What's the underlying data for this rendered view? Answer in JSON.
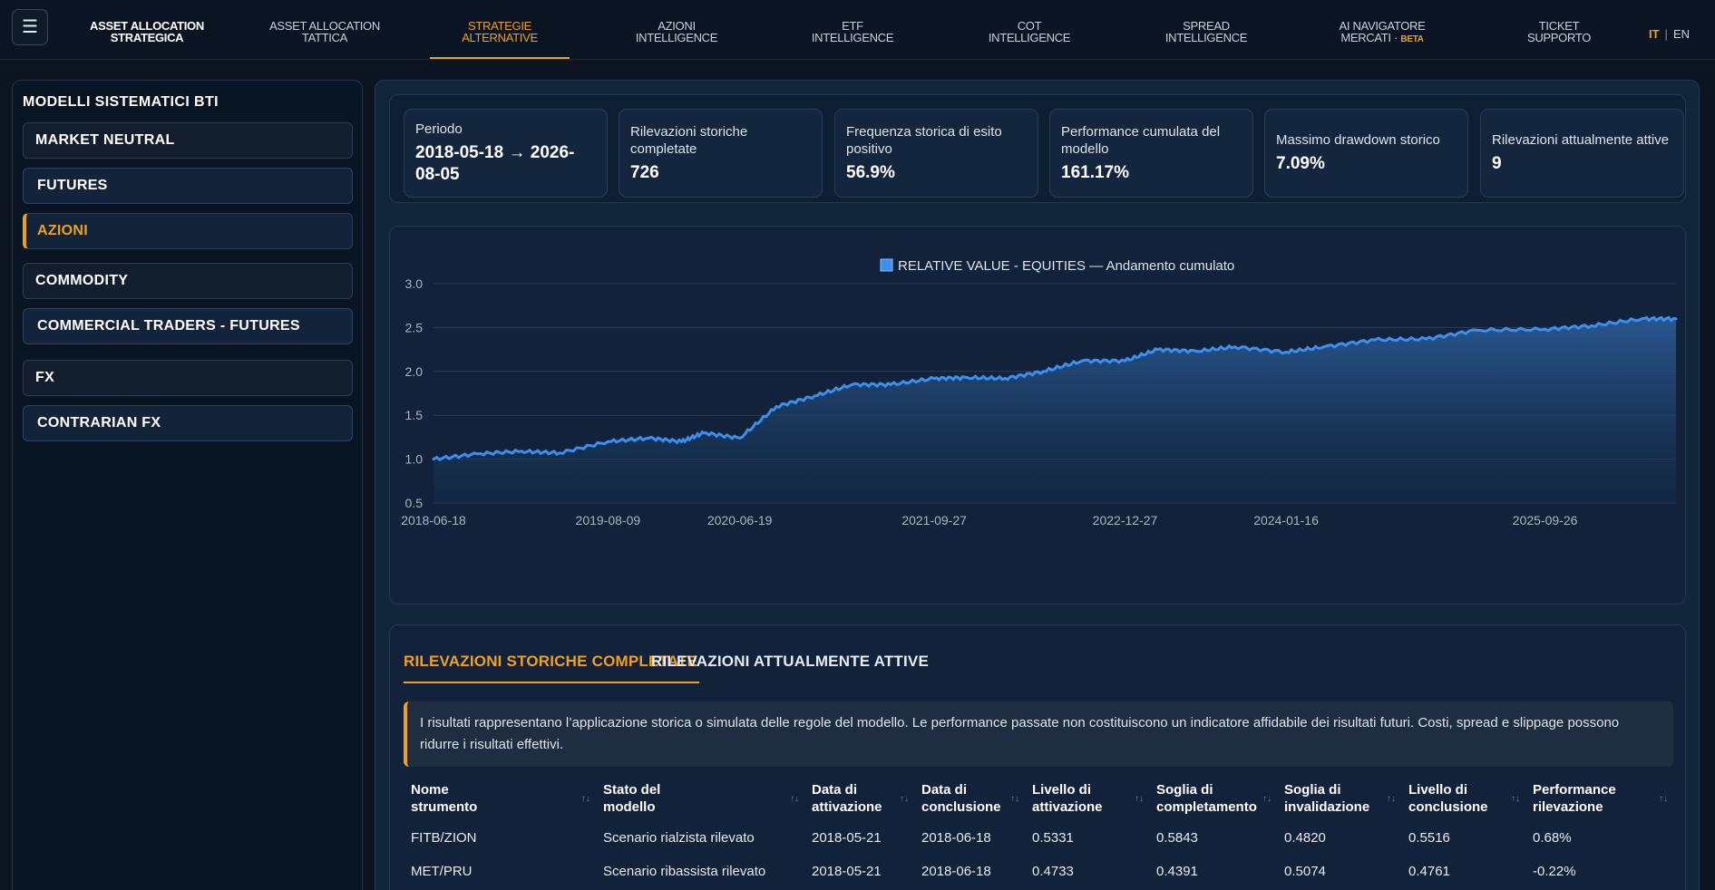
{
  "nav": {
    "items": [
      {
        "l1": "ASSET ALLOCATION",
        "l2": "STRATEGICA"
      },
      {
        "l1": "ASSET ALLOCATION",
        "l2": "TATTICA"
      },
      {
        "l1": "STRATEGIE",
        "l2": "ALTERNATIVE"
      },
      {
        "l1": "AZIONI",
        "l2": "INTELLIGENCE"
      },
      {
        "l1": "ETF",
        "l2": "INTELLIGENCE"
      },
      {
        "l1": "COT",
        "l2": "INTELLIGENCE"
      },
      {
        "l1": "SPREAD",
        "l2": "INTELLIGENCE"
      },
      {
        "l1": "AI NAVIGATORE",
        "l2": "MERCATI",
        "badge": "BETA"
      },
      {
        "l1": "TICKET",
        "l2": "SUPPORTO"
      }
    ],
    "active_index": 2,
    "menu_icon": "☰",
    "lang_it": "IT",
    "lang_sep": "|",
    "lang_en": "EN"
  },
  "sidebar": {
    "title": "MODELLI SISTEMATICI BTI",
    "items": [
      {
        "label": "MARKET NEUTRAL"
      },
      {
        "label": "FUTURES"
      },
      {
        "label": "AZIONI"
      },
      {
        "label": "COMMODITY"
      },
      {
        "label": "COMMERCIAL TRADERS - FUTURES"
      },
      {
        "label": "FX"
      },
      {
        "label": "CONTRARIAN FX"
      }
    ],
    "active_index": 2
  },
  "stats": [
    {
      "label": "Periodo",
      "value": "2018-05-18 → 2026-08-05"
    },
    {
      "label": "Rilevazioni storiche completate",
      "value": "726"
    },
    {
      "label": "Frequenza storica di esito positivo",
      "value": "56.9%"
    },
    {
      "label": "Performance cumulata del modello",
      "value": "161.17%"
    },
    {
      "label": "Massimo drawdown storico",
      "value": "7.09%"
    },
    {
      "label": "Rilevazioni attualmente attive",
      "value": "9"
    }
  ],
  "chart_data": {
    "type": "area",
    "legend": "RELATIVE VALUE - EQUITIES — Andamento cumulato",
    "ylim": [
      0.5,
      3.0
    ],
    "yticks": [
      "0.5",
      "1.0",
      "1.5",
      "2.0",
      "2.5",
      "3.0"
    ],
    "xticks": [
      "2018-06-18",
      "2019-08-09",
      "2020-06-19",
      "2021-09-27",
      "2022-12-27",
      "2024-01-16",
      "2025-09-26"
    ],
    "x": [
      "2018-06-18",
      "2018-10-01",
      "2019-01-15",
      "2019-04-15",
      "2019-08-09",
      "2019-11-15",
      "2020-02-01",
      "2020-03-25",
      "2020-06-19",
      "2020-09-15",
      "2020-12-15",
      "2021-03-15",
      "2021-06-15",
      "2021-09-27",
      "2021-12-15",
      "2022-03-15",
      "2022-06-15",
      "2022-09-15",
      "2022-12-27",
      "2023-03-15",
      "2023-06-15",
      "2023-09-15",
      "2024-01-16",
      "2024-04-15",
      "2024-08-15",
      "2024-12-15",
      "2025-04-15",
      "2025-09-26",
      "2026-01-15",
      "2026-05-15",
      "2026-08-05"
    ],
    "values": [
      1.0,
      1.06,
      1.09,
      1.07,
      1.2,
      1.24,
      1.2,
      1.3,
      1.24,
      1.6,
      1.72,
      1.85,
      1.85,
      1.92,
      1.93,
      1.92,
      2.0,
      2.12,
      2.12,
      2.25,
      2.23,
      2.28,
      2.22,
      2.28,
      2.36,
      2.37,
      2.47,
      2.48,
      2.52,
      2.6,
      2.6
    ],
    "line_color": "#3d8fee",
    "fill_color": "#2a5a94"
  },
  "tabs": {
    "completed": "RILEVAZIONI STORICHE COMPLETATE",
    "active": "RILEVAZIONI ATTUALMENTE ATTIVE"
  },
  "disclaimer": "I risultati rappresentano l’applicazione storica o simulata delle regole del modello. Le performance passate non costituiscono un indicatore affidabile dei risultati futuri. Costi, spread e slippage possono ridurre i risultati effettivi.",
  "table": {
    "headers": [
      {
        "l1": "Nome",
        "l2": "strumento"
      },
      {
        "l1": "Stato del",
        "l2": "modello"
      },
      {
        "l1": "Data di",
        "l2": "attivazione"
      },
      {
        "l1": "Data di",
        "l2": "conclusione"
      },
      {
        "l1": "Livello di",
        "l2": "attivazione"
      },
      {
        "l1": "Soglia di",
        "l2": "completamento"
      },
      {
        "l1": "Soglia di",
        "l2": "invalidazione"
      },
      {
        "l1": "Livello di",
        "l2": "conclusione"
      },
      {
        "l1": "Performance",
        "l2": "rilevazione"
      }
    ],
    "sort_icon": "↑↓",
    "rows": [
      [
        "FITB/ZION",
        "Scenario rialzista rilevato",
        "2018-05-21",
        "2018-06-18",
        "0.5331",
        "0.5843",
        "0.4820",
        "0.5516",
        "0.68%"
      ],
      [
        "MET/PRU",
        "Scenario ribassista rilevato",
        "2018-05-21",
        "2018-06-18",
        "0.4733",
        "0.4391",
        "0.5074",
        "0.4761",
        "-0.22%"
      ]
    ]
  }
}
